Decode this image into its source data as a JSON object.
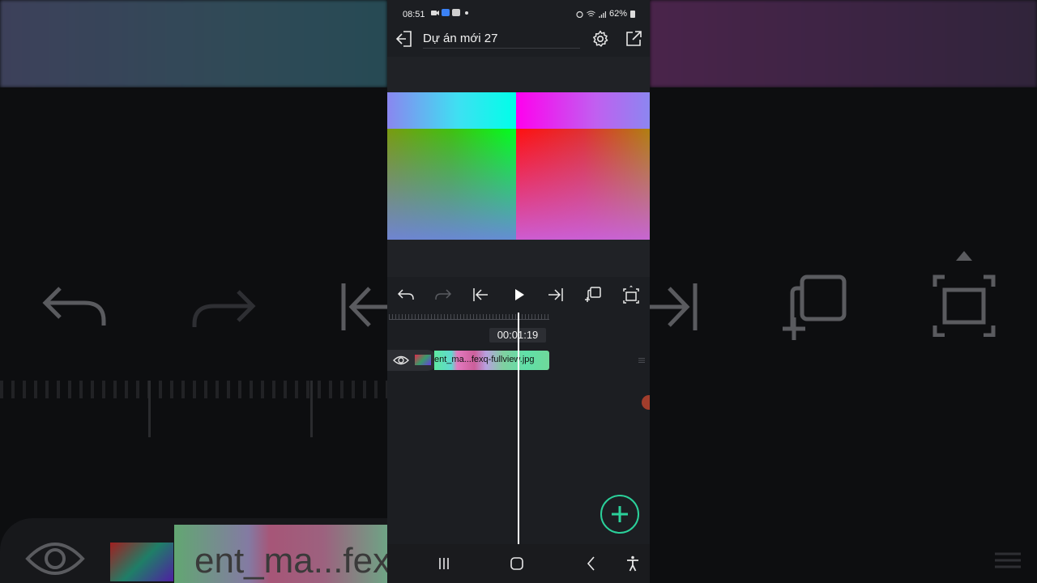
{
  "status_bar": {
    "time": "08:51",
    "battery": "62%"
  },
  "app_bar": {
    "title": "Dự án mới 27"
  },
  "timeline": {
    "timecode": "00:01:19",
    "clip_name": "ent_ma...fexq-fullview.jpg"
  },
  "backdrop": {
    "clip_text": "ent_ma...fexq"
  },
  "colors": {
    "accent": "#2bd09a",
    "background": "#1c1e22",
    "playhead": "#ffffff"
  },
  "icons": [
    "exit-icon",
    "settings-icon",
    "share-icon",
    "undo-icon",
    "redo-icon",
    "skip-start-icon",
    "play-icon",
    "skip-end-icon",
    "duplicate-icon",
    "fullscreen-icon",
    "eye-icon",
    "add-icon",
    "recents-icon",
    "home-icon",
    "back-icon",
    "accessibility-icon"
  ]
}
